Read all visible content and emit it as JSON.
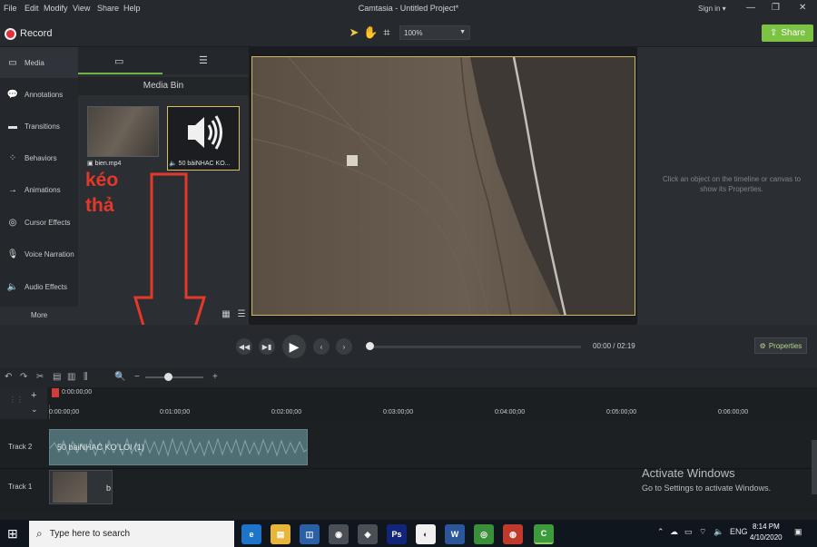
{
  "menubar": {
    "items": [
      "File",
      "Edit",
      "Modify",
      "View",
      "Share",
      "Help"
    ],
    "title": "Camtasia - Untitled Project*",
    "signin": "Sign in ▾"
  },
  "toolbar": {
    "record_label": "Record",
    "zoom_value": "100%",
    "share_label": "Share"
  },
  "sidebar": {
    "items": [
      {
        "label": "Media",
        "icon": "media-icon"
      },
      {
        "label": "Annotations",
        "icon": "annotations-icon"
      },
      {
        "label": "Transitions",
        "icon": "transitions-icon"
      },
      {
        "label": "Behaviors",
        "icon": "behaviors-icon"
      },
      {
        "label": "Animations",
        "icon": "animations-icon"
      },
      {
        "label": "Cursor Effects",
        "icon": "cursor-effects-icon"
      },
      {
        "label": "Voice Narration",
        "icon": "microphone-icon"
      },
      {
        "label": "Audio Effects",
        "icon": "speaker-icon"
      }
    ],
    "more_label": "More"
  },
  "media_bin": {
    "title": "Media Bin",
    "items": [
      {
        "label": "bien.mp4",
        "type": "video"
      },
      {
        "label": "50 bàiNHAC KO...",
        "type": "audio"
      }
    ],
    "annotation_text_line1": "kéo",
    "annotation_text_line2": "thả"
  },
  "properties": {
    "hint": "Click an object on the timeline or canvas to show its Properties.",
    "button_label": "Properties"
  },
  "playback": {
    "current_time": "00:00",
    "separator": "/",
    "total_time": "02:19"
  },
  "timeline": {
    "playhead_time": "0:00:00;00",
    "ruler_labels": [
      "0:00:00;00",
      "0:01:00;00",
      "0:02:00;00",
      "0:03:00;00",
      "0:04:00;00",
      "0:05:00;00",
      "0:06:00;00"
    ],
    "tracks": [
      {
        "name": "Track 2",
        "clip_label": "50 bàiNHAC KO LOI (1)"
      },
      {
        "name": "Track 1",
        "clip_label": "b"
      }
    ]
  },
  "watermark": {
    "line1": "Activate Windows",
    "line2": "Go to Settings to activate Windows."
  },
  "taskbar": {
    "search_placeholder": "Type here to search",
    "language": "ENG",
    "time": "8:14 PM",
    "date": "4/10/2020"
  },
  "colors": {
    "accent_green": "#7cc243",
    "record_red": "#e0303a",
    "annotation_red": "#e53828",
    "selection_yellow": "#d8c060"
  }
}
